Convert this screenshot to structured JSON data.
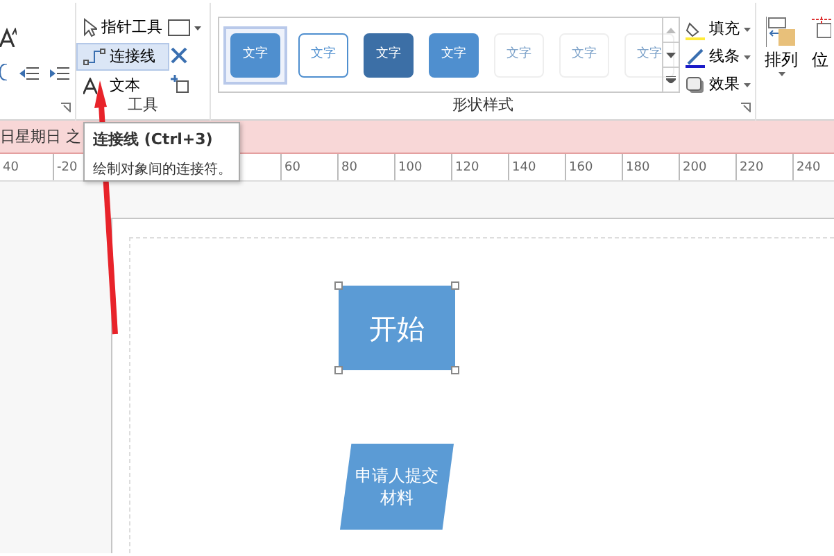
{
  "ribbon": {
    "tools_group": {
      "label": "工具",
      "items": [
        {
          "label": "指针工具",
          "selected": false
        },
        {
          "label": "连接线",
          "selected": true
        },
        {
          "label": "文本",
          "selected": false
        }
      ]
    },
    "styles_group": {
      "label": "形状样式",
      "swatches": [
        {
          "kind": "filled",
          "label": "文字",
          "selected": true
        },
        {
          "kind": "outline",
          "label": "文字",
          "selected": false
        },
        {
          "kind": "dark",
          "label": "文字",
          "selected": false
        },
        {
          "kind": "filled",
          "label": "文字",
          "selected": false
        },
        {
          "kind": "light",
          "label": "文字",
          "selected": false
        },
        {
          "kind": "light",
          "label": "文字",
          "selected": false
        },
        {
          "kind": "light",
          "label": "文字",
          "selected": false
        }
      ],
      "format_items": [
        {
          "kind": "fill",
          "label": "填充"
        },
        {
          "kind": "line",
          "label": "线条"
        },
        {
          "kind": "effect",
          "label": "效果"
        }
      ]
    },
    "arrange": {
      "label": "排列",
      "cut_label": "位"
    }
  },
  "info_bar": {
    "text": "日星期日 之"
  },
  "ruler": {
    "left_labels": [
      "40",
      "-20"
    ],
    "right_labels": [
      "60",
      "80",
      "100",
      "120",
      "140",
      "160",
      "180",
      "200",
      "220",
      "240"
    ]
  },
  "tooltip": {
    "title": "连接线 (Ctrl+3)",
    "description": "绘制对象间的连接符。"
  },
  "canvas": {
    "shapes": [
      {
        "kind": "process",
        "text": "开始",
        "selected": true
      },
      {
        "kind": "data",
        "text": "申请人提交材料",
        "selected": false
      }
    ]
  }
}
